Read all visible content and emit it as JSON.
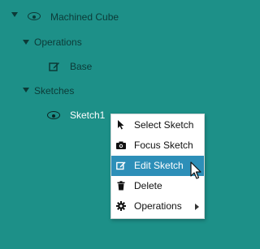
{
  "tree": {
    "root_label": "Machined Cube",
    "operations_label": "Operations",
    "base_label": "Base",
    "sketches_label": "Sketches",
    "sketch1_label": "Sketch1"
  },
  "context_menu": {
    "items": [
      {
        "label": "Select Sketch",
        "icon": "cursor-arrow-icon"
      },
      {
        "label": "Focus Sketch",
        "icon": "camera-icon"
      },
      {
        "label": "Edit Sketch",
        "icon": "edit-icon",
        "active": true
      },
      {
        "label": "Delete",
        "icon": "trash-icon"
      },
      {
        "label": "Operations",
        "icon": "gear-icon",
        "has_submenu": true
      }
    ],
    "accent": "#2d8fb8"
  },
  "colors": {
    "background": "#1d9088",
    "tree_text": "#0c3a37"
  }
}
